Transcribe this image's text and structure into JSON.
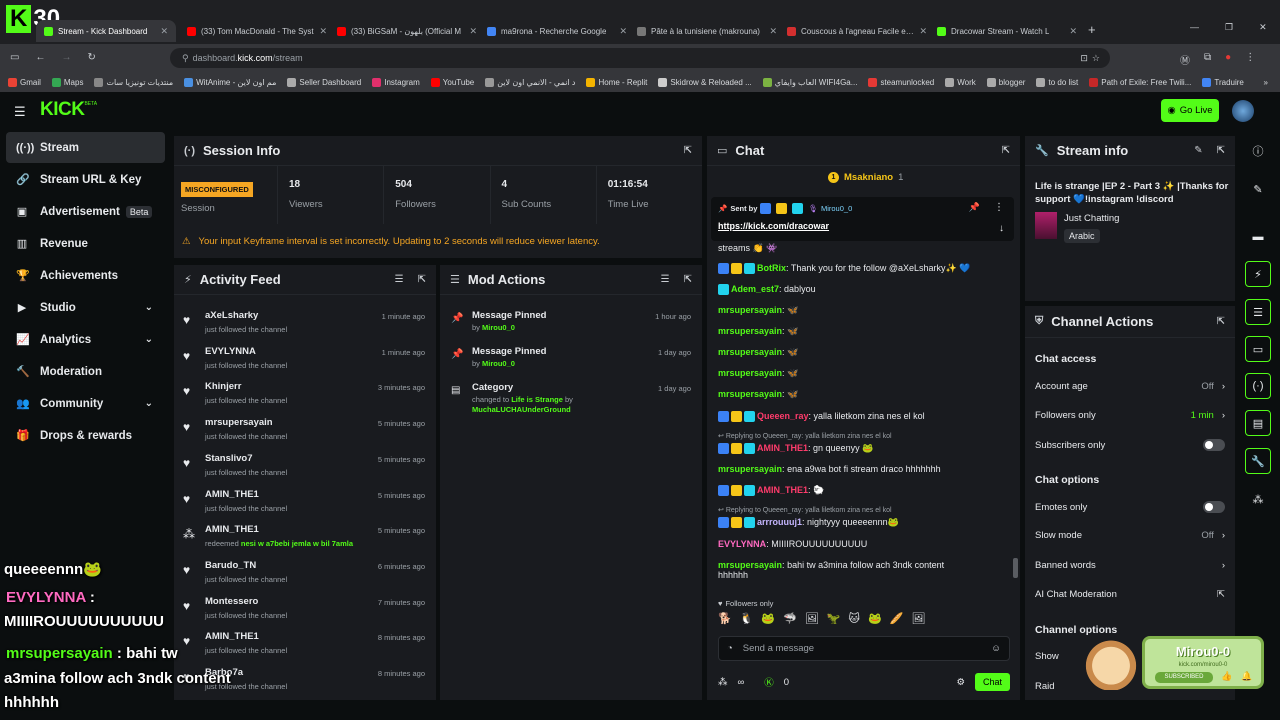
{
  "browser": {
    "tabs": [
      {
        "label": "Stream - Kick Dashboard",
        "color": "#53fc18",
        "active": true
      },
      {
        "label": "(33) Tom MacDonald - The Syst",
        "color": "#ff0000"
      },
      {
        "label": "(33) BiGSaM - بلهون (Official M",
        "color": "#ff0000"
      },
      {
        "label": "ma9rona - Recherche Google",
        "color": "#4285f4"
      },
      {
        "label": "Pâte à la tunisiene (makrouna)",
        "color": "#777777"
      },
      {
        "label": "Couscous à l'agneau Facile et ra",
        "color": "#d32f2f"
      },
      {
        "label": "Dracowar Stream - Watch L",
        "color": "#53fc18"
      }
    ],
    "url_host": "dashboard.",
    "url_domain": "kick.com",
    "url_path": "/stream",
    "bookmarks": [
      "Gmail",
      "Maps",
      "منتديات تونيزيا سات",
      "WitAnime - مم اون لاين",
      "Seller Dashboard",
      "Instagram",
      "YouTube",
      "د انمي - الانمي اون لاين",
      "Home - Replit",
      "Skidrow & Reloaded ...",
      "العاب وايفاي WIFI4Ga...",
      "steamunlocked",
      "Work",
      "blogger",
      "to do list",
      "Path of Exile: Free Twili...",
      "Traduire"
    ]
  },
  "overlay_logo": {
    "letter": "K",
    "number": "30"
  },
  "header": {
    "logo": "KICK",
    "logo_sup": "BETA",
    "go_live": "Go Live"
  },
  "sidebar": {
    "items": [
      {
        "label": "Stream",
        "icon": "broadcast-icon",
        "glyph": "((·))",
        "active": true
      },
      {
        "label": "Stream URL & Key",
        "icon": "link-icon",
        "glyph": "🔗"
      },
      {
        "label": "Advertisement",
        "icon": "ad-icon",
        "glyph": "▣",
        "badge": "Beta"
      },
      {
        "label": "Revenue",
        "icon": "chart-icon",
        "glyph": "▥"
      },
      {
        "label": "Achievements",
        "icon": "trophy-icon",
        "glyph": "🏆"
      },
      {
        "label": "Studio",
        "icon": "studio-icon",
        "glyph": "▶",
        "chevron": true
      },
      {
        "label": "Analytics",
        "icon": "analytics-icon",
        "glyph": "📈",
        "chevron": true
      },
      {
        "label": "Moderation",
        "icon": "hammer-icon",
        "glyph": "🔨"
      },
      {
        "label": "Community",
        "icon": "community-icon",
        "glyph": "👥",
        "chevron": true
      },
      {
        "label": "Drops & rewards",
        "icon": "gift-icon",
        "glyph": "🎁"
      }
    ]
  },
  "session": {
    "title": "Session Info",
    "status": "MISCONFIGURED",
    "status_label": "Session",
    "stats": [
      {
        "value": "18",
        "label": "Viewers"
      },
      {
        "value": "504",
        "label": "Followers"
      },
      {
        "value": "4",
        "label": "Sub Counts"
      },
      {
        "value": "01:16:54",
        "label": "Time Live"
      }
    ],
    "warning": "Your input Keyframe interval is set incorrectly. Updating to 2 seconds will reduce viewer latency."
  },
  "activity": {
    "title": "Activity Feed",
    "rows": [
      {
        "name": "aXeLsharky",
        "sub": "just followed the channel",
        "time": "1 minute ago"
      },
      {
        "name": "EVYLYNNA",
        "sub": "just followed the channel",
        "time": "1 minute ago"
      },
      {
        "name": "Khinjerr",
        "sub": "just followed the channel",
        "time": "3 minutes ago"
      },
      {
        "name": "mrsupersayain",
        "sub": "just followed the channel",
        "time": "5 minutes ago"
      },
      {
        "name": "Stanslivo7",
        "sub": "just followed the channel",
        "time": "5 minutes ago"
      },
      {
        "name": "AMIN_THE1",
        "sub": "just followed the channel",
        "time": "5 minutes ago"
      },
      {
        "name": "AMIN_THE1",
        "sub": "redeemed",
        "reward": "nesi w a7bebi jemla w bil 7amla",
        "time": "5 minutes ago"
      },
      {
        "name": "Barudo_TN",
        "sub": "just followed the channel",
        "time": "6 minutes ago"
      },
      {
        "name": "Montessero",
        "sub": "just followed the channel",
        "time": "7 minutes ago"
      },
      {
        "name": "AMIN_THE1",
        "sub": "just followed the channel",
        "time": "8 minutes ago"
      },
      {
        "name": "Barbo7a",
        "sub": "just followed the channel",
        "time": "8 minutes ago"
      }
    ]
  },
  "mod": {
    "title": "Mod Actions",
    "rows": [
      {
        "title": "Message Pinned",
        "by": "by",
        "user": "Mirou0_0",
        "time": "1 hour ago"
      },
      {
        "title": "Message Pinned",
        "by": "by",
        "user": "Mirou0_0",
        "time": "1 day ago"
      },
      {
        "title": "Category",
        "by": "changed to",
        "user": "Life is Strange",
        "by2": "by",
        "user2": "MuchaLUCHAUnderGround",
        "time": "1 day ago"
      }
    ]
  },
  "chat": {
    "title": "Chat",
    "top_user": "Msakniano",
    "top_count": "1",
    "pinned_label": "Sent by",
    "pinned_user": "Mirou0_0",
    "pinned_link": "https://kick.com/dracowar",
    "streams_text": "streams",
    "lines": [
      {
        "user": "BotRix",
        "color": "#53fc18",
        "text": "Thank you for the follow @aXeLsharky✨ 💙"
      },
      {
        "user": "Adem_est7",
        "color": "#53fc18",
        "text": "dablyou"
      },
      {
        "user": "mrsupersayain",
        "color": "#53fc18",
        "text": "🦋"
      },
      {
        "user": "mrsupersayain",
        "color": "#53fc18",
        "text": "🦋"
      },
      {
        "user": "mrsupersayain",
        "color": "#53fc18",
        "text": "🦋"
      },
      {
        "user": "mrsupersayain",
        "color": "#53fc18",
        "text": "🦋"
      },
      {
        "user": "mrsupersayain",
        "color": "#53fc18",
        "text": "🦋"
      },
      {
        "user": "Queeen_ray",
        "color": "#ff3b6b",
        "text": "yalla liletkom zina nes el kol"
      },
      {
        "user": "AMIN_THE1",
        "color": "#ff3b6b",
        "text": "gn queenyy 🐸",
        "reply": "Replying to Queeen_ray: yalla liletkom zina nes el kol"
      },
      {
        "user": "mrsupersayain",
        "color": "#53fc18",
        "text": "ena a9wa bot fi stream draco hhhhhhh"
      },
      {
        "user": "AMIN_THE1",
        "color": "#ff3b6b",
        "text": "🐑"
      },
      {
        "user": "arrrouuuj1",
        "color": "#c4b5fd",
        "text": "nightyyy queeeennn🐸",
        "reply": "Replying to Queeen_ray: yalla liletkom zina nes el kol"
      },
      {
        "user": "EVYLYNNA",
        "color": "#ff6ac1",
        "text": "MIIIIROUUUUUUUUUU"
      },
      {
        "user": "mrsupersayain",
        "color": "#53fc18",
        "text": "bahi tw a3mina follow ach 3ndk content",
        "text2": "hhhhhh"
      }
    ],
    "followers_only": "Followers only",
    "placeholder": "Send a message",
    "points": "0",
    "send": "Chat"
  },
  "stream_info": {
    "title": "Stream info",
    "stream_title": "Life is strange |EP 2 - Part 3 ✨ |Thanks for support 💙!instagram !discord",
    "category": "Just Chatting",
    "tag": "Arabic"
  },
  "channel_actions": {
    "title": "Channel Actions",
    "chat_access": "Chat access",
    "account_age": {
      "label": "Account age",
      "value": "Off"
    },
    "followers_only": {
      "label": "Followers only",
      "value": "1 min"
    },
    "subscribers_only": {
      "label": "Subscribers only"
    },
    "chat_options": "Chat options",
    "emotes_only": {
      "label": "Emotes only"
    },
    "slow_mode": {
      "label": "Slow mode",
      "value": "Off"
    },
    "banned_words": {
      "label": "Banned words"
    },
    "ai_moderation": {
      "label": "AI Chat Moderation"
    },
    "channel_options": "Channel options",
    "show_label": "Show",
    "raid_label": "Raid"
  },
  "overlay_chat": [
    {
      "text": "queeeennn🐸",
      "color": "#ffffff"
    },
    {
      "text": "EVYLYNNA",
      "color": "#ff6ac1",
      "suffix": " :"
    },
    {
      "text": "MIIIIROUUUUUUUUUU",
      "color": "#ffffff"
    },
    {
      "text": "mrsupersayain",
      "color": "#53fc18",
      "suffix": " : bahi tw"
    },
    {
      "text": "a3mina follow ach 3ndk content",
      "color": "#ffffff"
    },
    {
      "text": "hhhhhh",
      "color": "#ffffff"
    }
  ],
  "sub_card": {
    "user": "Mirou0-0",
    "url": "kick.com/mirou0-0",
    "label": "SUBSCRIBED"
  },
  "colors": {
    "kick_green": "#53fc18",
    "panel": "#191b1f",
    "bg": "#0b0e0f",
    "warn": "#f5a623"
  }
}
